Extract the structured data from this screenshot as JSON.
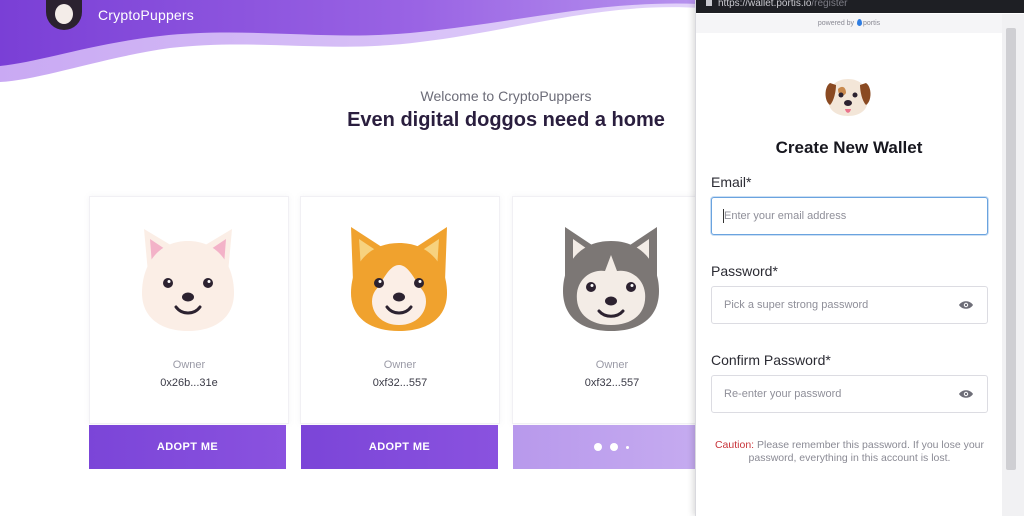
{
  "app": {
    "brand_name": "CryptoPuppers",
    "welcome": "Welcome to CryptoPuppers",
    "headline": "Even digital doggos need a home"
  },
  "colors": {
    "accent_purple": "#7b45d8",
    "accent_purple_light": "#c6acf0",
    "input_focus": "#6aa3df",
    "caution_red": "#c8343a"
  },
  "cards": [
    {
      "dog": "white-dog",
      "owner_label": "Owner",
      "owner_address": "0x26b...31e",
      "button_label": "ADOPT ME",
      "state": "ready"
    },
    {
      "dog": "corgi-dog",
      "owner_label": "Owner",
      "owner_address": "0xf32...557",
      "button_label": "ADOPT ME",
      "state": "ready"
    },
    {
      "dog": "husky-dog",
      "owner_label": "Owner",
      "owner_address": "0xf32...557",
      "button_label": "",
      "state": "loading"
    }
  ],
  "popup": {
    "url_host": "https://wallet.portis.io",
    "url_path": "/register",
    "powered_by": "powered by",
    "powered_brand": "portis",
    "title": "Create New Wallet",
    "email": {
      "label": "Email",
      "required": "*",
      "placeholder": "Enter your email address",
      "value": ""
    },
    "password": {
      "label": "Password",
      "required": "*",
      "placeholder": "Pick a super strong password",
      "value": ""
    },
    "confirm": {
      "label": "Confirm Password",
      "required": "*",
      "placeholder": "Re-enter your password",
      "value": ""
    },
    "caution_label": "Caution:",
    "caution_text": "Please remember this password. If you lose your password, everything in this account is lost."
  }
}
